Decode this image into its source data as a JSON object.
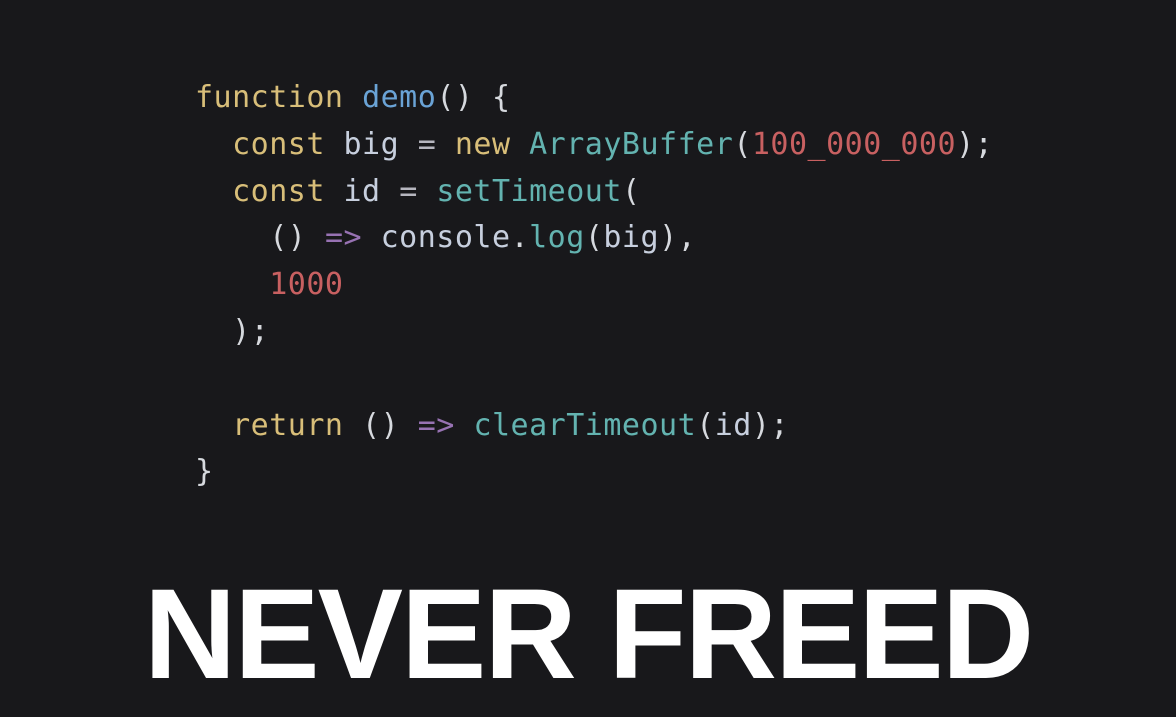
{
  "caption": "NEVER FREED",
  "code": {
    "lines": [
      [
        {
          "cls": "tk-keyword",
          "t": "function"
        },
        {
          "cls": "tk-punct",
          "t": " "
        },
        {
          "cls": "tk-fn-name",
          "t": "demo"
        },
        {
          "cls": "tk-punct",
          "t": "() {"
        }
      ],
      [
        {
          "cls": "tk-punct",
          "t": "  "
        },
        {
          "cls": "tk-keyword",
          "t": "const"
        },
        {
          "cls": "tk-punct",
          "t": " "
        },
        {
          "cls": "tk-var",
          "t": "big"
        },
        {
          "cls": "tk-punct",
          "t": " "
        },
        {
          "cls": "tk-op",
          "t": "="
        },
        {
          "cls": "tk-punct",
          "t": " "
        },
        {
          "cls": "tk-keyword",
          "t": "new"
        },
        {
          "cls": "tk-punct",
          "t": " "
        },
        {
          "cls": "tk-type",
          "t": "ArrayBuffer"
        },
        {
          "cls": "tk-punct",
          "t": "("
        },
        {
          "cls": "tk-num",
          "t": "100_000_000"
        },
        {
          "cls": "tk-punct",
          "t": ");"
        }
      ],
      [
        {
          "cls": "tk-punct",
          "t": "  "
        },
        {
          "cls": "tk-keyword",
          "t": "const"
        },
        {
          "cls": "tk-punct",
          "t": " "
        },
        {
          "cls": "tk-var",
          "t": "id"
        },
        {
          "cls": "tk-punct",
          "t": " "
        },
        {
          "cls": "tk-op",
          "t": "="
        },
        {
          "cls": "tk-punct",
          "t": " "
        },
        {
          "cls": "tk-call",
          "t": "setTimeout"
        },
        {
          "cls": "tk-punct",
          "t": "("
        }
      ],
      [
        {
          "cls": "tk-punct",
          "t": "    () "
        },
        {
          "cls": "tk-arrow",
          "t": "=>"
        },
        {
          "cls": "tk-punct",
          "t": " "
        },
        {
          "cls": "tk-obj",
          "t": "console"
        },
        {
          "cls": "tk-punct",
          "t": "."
        },
        {
          "cls": "tk-call",
          "t": "log"
        },
        {
          "cls": "tk-punct",
          "t": "("
        },
        {
          "cls": "tk-var",
          "t": "big"
        },
        {
          "cls": "tk-punct",
          "t": "),"
        }
      ],
      [
        {
          "cls": "tk-punct",
          "t": "    "
        },
        {
          "cls": "tk-num",
          "t": "1000"
        }
      ],
      [
        {
          "cls": "tk-punct",
          "t": "  );"
        }
      ],
      [
        {
          "cls": "tk-punct",
          "t": ""
        }
      ],
      [
        {
          "cls": "tk-punct",
          "t": "  "
        },
        {
          "cls": "tk-keyword",
          "t": "return"
        },
        {
          "cls": "tk-punct",
          "t": " () "
        },
        {
          "cls": "tk-arrow",
          "t": "=>"
        },
        {
          "cls": "tk-punct",
          "t": " "
        },
        {
          "cls": "tk-call",
          "t": "clearTimeout"
        },
        {
          "cls": "tk-punct",
          "t": "("
        },
        {
          "cls": "tk-var",
          "t": "id"
        },
        {
          "cls": "tk-punct",
          "t": ");"
        }
      ],
      [
        {
          "cls": "tk-punct",
          "t": "}"
        }
      ]
    ]
  }
}
